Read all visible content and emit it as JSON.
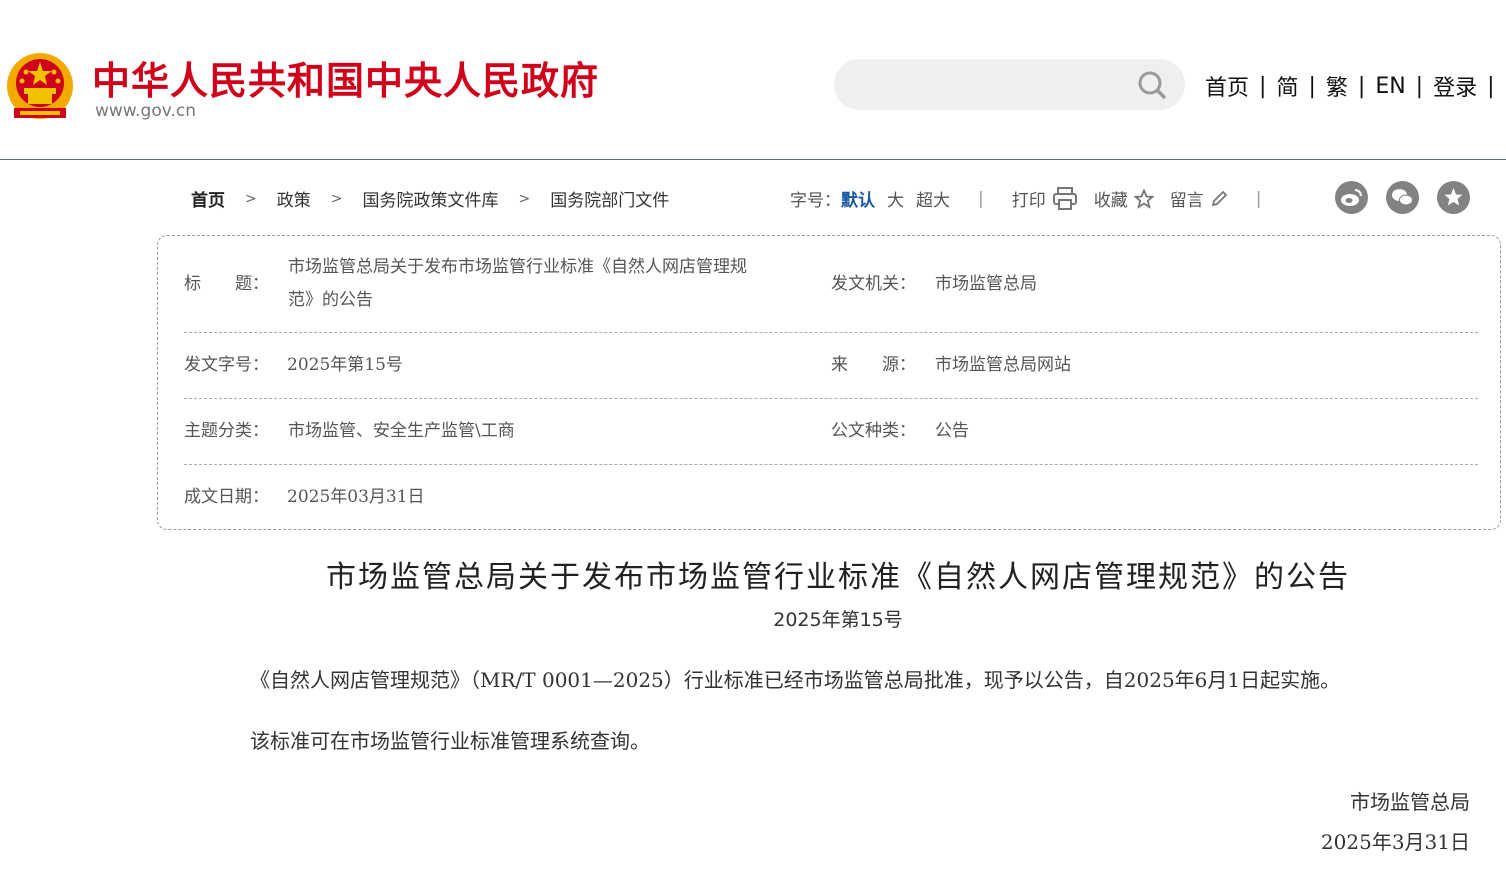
{
  "header": {
    "site_name": "中华人民共和国中央人民政府",
    "site_url": "www.gov.cn",
    "search": {
      "placeholder": ""
    },
    "nav": [
      "首页",
      "简",
      "繁",
      "EN",
      "登录"
    ]
  },
  "breadcrumb": [
    "首页",
    "政策",
    "国务院政策文件库",
    "国务院部门文件"
  ],
  "tools": {
    "font_label": "字号：",
    "font_sizes": [
      "默认",
      "大",
      "超大"
    ],
    "print": "打印",
    "favorite": "收藏",
    "comment": "留言"
  },
  "info": {
    "title_label": "标　　题：",
    "title_line1": "市场监管总局关于发布市场监管行业标准《自然人网店管理规",
    "title_line2": "范》的公告",
    "issuer_label": "发文机关：",
    "issuer": "市场监管总局",
    "doc_no_label": "发文字号：",
    "doc_no": "2025年第15号",
    "source_label": "来　　源：",
    "source": "市场监管总局网站",
    "topic_label": "主题分类：",
    "topic": "市场监管、安全生产监管\\工商",
    "type_label": "公文种类：",
    "type": "公告",
    "date_label": "成文日期：",
    "date": "2025年03月31日"
  },
  "article": {
    "title": "市场监管总局关于发布市场监管行业标准《自然人网店管理规范》的公告",
    "doc_no": "2025年第15号",
    "paragraphs": [
      "《自然人网店管理规范》（MR/T 0001—2025）行业标准已经市场监管总局批准，现予以公告，自2025年6月1日起实施。",
      "该标准可在市场监管行业标准管理系统查询。"
    ],
    "signature": "市场监管总局",
    "sign_date": "2025年3月31日"
  },
  "colors": {
    "brand_red": "#d0021b",
    "accent_blue": "#1a56a8",
    "share_gray": "#828282"
  }
}
